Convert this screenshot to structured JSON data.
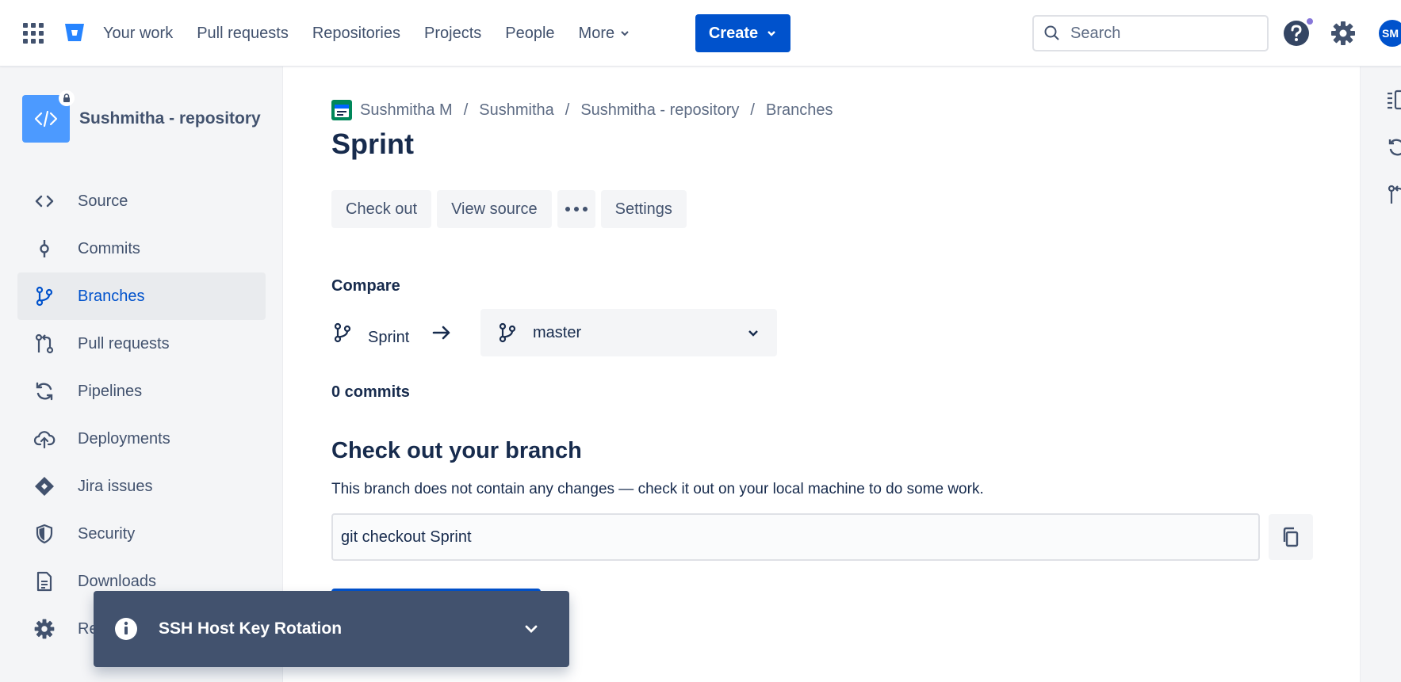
{
  "topnav": {
    "apps_icon": "app-switcher-grid-icon",
    "logo_icon": "bitbucket-logo-icon",
    "items": [
      {
        "label": "Your work"
      },
      {
        "label": "Pull requests"
      },
      {
        "label": "Repositories"
      },
      {
        "label": "Projects"
      },
      {
        "label": "People"
      },
      {
        "label": "More",
        "has_dropdown": true
      }
    ],
    "create_label": "Create",
    "search_placeholder": "Search",
    "avatar_initials": "SM",
    "accent_color": "#0052cc",
    "notification_dot_color": "#8777d9"
  },
  "sidebar": {
    "repo_name": "Sushmitha - repository",
    "repo_private": true,
    "items": [
      {
        "label": "Source",
        "icon": "code-icon"
      },
      {
        "label": "Commits",
        "icon": "commit-icon"
      },
      {
        "label": "Branches",
        "icon": "branch-icon",
        "active": true
      },
      {
        "label": "Pull requests",
        "icon": "pull-request-icon"
      },
      {
        "label": "Pipelines",
        "icon": "pipelines-icon"
      },
      {
        "label": "Deployments",
        "icon": "cloud-upload-icon"
      },
      {
        "label": "Jira issues",
        "icon": "jira-icon"
      },
      {
        "label": "Security",
        "icon": "shield-icon"
      },
      {
        "label": "Downloads",
        "icon": "file-icon"
      },
      {
        "label": "Re",
        "icon": "gear-icon"
      }
    ]
  },
  "breadcrumb": [
    "Sushmitha M",
    "Sushmitha",
    "Sushmitha - repository",
    "Branches"
  ],
  "page_title": "Sprint",
  "actions": {
    "checkout": "Check out",
    "view_source": "View source",
    "more": "•••",
    "settings": "Settings"
  },
  "compare": {
    "label": "Compare",
    "source_branch": "Sprint",
    "target_branch": "master"
  },
  "commits_count": "0 commits",
  "checkout_section": {
    "title": "Check out your branch",
    "description": "This branch does not contain any changes — check it out on your local machine to do some work.",
    "command": "git checkout Sprint"
  },
  "flag": {
    "text": "SSH Host Key Rotation",
    "icon": "info-icon"
  }
}
